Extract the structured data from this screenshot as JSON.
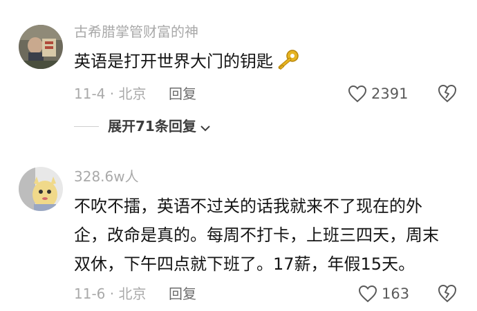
{
  "comments": [
    {
      "username": "古希腊掌管财富的神",
      "text": "英语是打开世界大门的钥匙",
      "emoji_icon": "key-icon",
      "date_location": "11-4 · 北京",
      "reply_label": "回复",
      "like_count": "2391",
      "expand_label": "展开71条回复"
    },
    {
      "username": "328.6w人",
      "text": "不吹不擂，英语不过关的话我就来不了现在的外企，改命是真的。每周不打卡，上班三四天，周末双休，下午四点就下班了。17薪，年假15天。",
      "date_location": "11-6 · 北京",
      "reply_label": "回复",
      "like_count": "163"
    }
  ],
  "colors": {
    "meta_text": "#a9a9a9",
    "body_text": "#141414",
    "reply_text": "#6b6b6b",
    "key_gold": "#e6b422"
  }
}
